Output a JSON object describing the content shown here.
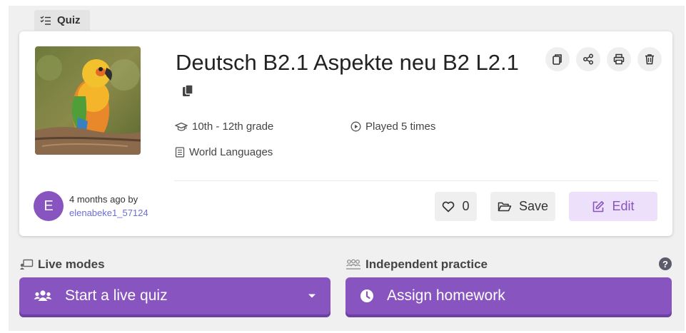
{
  "tag": {
    "label": "Quiz"
  },
  "quiz": {
    "title": "Deutsch B2.1 Aspekte neu B2 L2.1",
    "grade": "10th - 12th grade",
    "plays": "Played 5 times",
    "subject": "World Languages"
  },
  "author": {
    "initial": "E",
    "time": "4 months ago by",
    "username": "elenabeke1_57124"
  },
  "actions": {
    "like_count": "0",
    "save_label": "Save",
    "edit_label": "Edit"
  },
  "modes": {
    "live_label": "Live modes",
    "practice_label": "Independent practice",
    "help_glyph": "?",
    "start_label": "Start a live quiz",
    "assign_label": "Assign homework"
  },
  "colors": {
    "accent": "#8854c0",
    "accent_light": "#ede0fa",
    "username": "#6e6ed7"
  }
}
